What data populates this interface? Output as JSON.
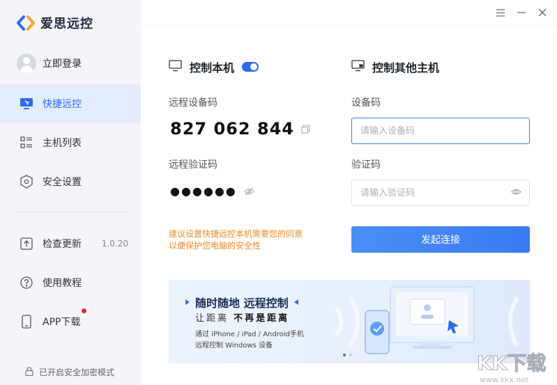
{
  "app": {
    "name": "爱思远控"
  },
  "sidebar": {
    "login_label": "立即登录",
    "items": [
      {
        "key": "quick",
        "label": "快捷远控",
        "icon": "monitor-cursor-icon",
        "active": true
      },
      {
        "key": "hosts",
        "label": "主机列表",
        "icon": "list-icon",
        "active": false
      },
      {
        "key": "security",
        "label": "安全设置",
        "icon": "shield-icon",
        "active": false
      }
    ],
    "bottom_items": [
      {
        "key": "update",
        "label": "检查更新",
        "icon": "upload-icon",
        "version": "1.0.20"
      },
      {
        "key": "tutorial",
        "label": "使用教程",
        "icon": "help-circle-icon"
      },
      {
        "key": "app",
        "label": "APP下载",
        "icon": "phone-icon",
        "badge": "red-dot"
      }
    ],
    "encrypt_label": "已开启安全加密模式"
  },
  "window": {
    "menu_icon": "menu-icon",
    "minimize_icon": "minimize-icon",
    "close_icon": "close-icon"
  },
  "local": {
    "title": "控制本机",
    "toggle_on": true,
    "device_code_label": "远程设备码",
    "device_code": "827 062 844",
    "verify_label": "远程验证码",
    "verify_masked": "●●●●●●",
    "notice_line1": "建议设置快捷远控本机需要您的同意",
    "notice_line2": "以便保护您电脑的安全性"
  },
  "remote": {
    "title": "控制其他主机",
    "device_code_label": "设备码",
    "device_code_placeholder": "请输入设备码",
    "verify_label": "验证码",
    "verify_placeholder": "请输入验证码",
    "connect_label": "发起连接"
  },
  "banner": {
    "title": "随时随地 远程控制",
    "sub_prefix": "让距离",
    "sub_bold": "不再是距离",
    "desc_line1": "通过 iPhone / iPad / Android手机",
    "desc_line2": "远程控制  Windows 设备",
    "pages": 2,
    "current_page": 1
  },
  "watermark": {
    "text": "KK下载",
    "url": "www.kkx.net"
  },
  "colors": {
    "accent": "#2b6cf0",
    "notice": "#f08a24",
    "badge": "#e5282a",
    "sidebar_bg": "#f3f5f9",
    "active_bg": "#e3ecfd"
  }
}
